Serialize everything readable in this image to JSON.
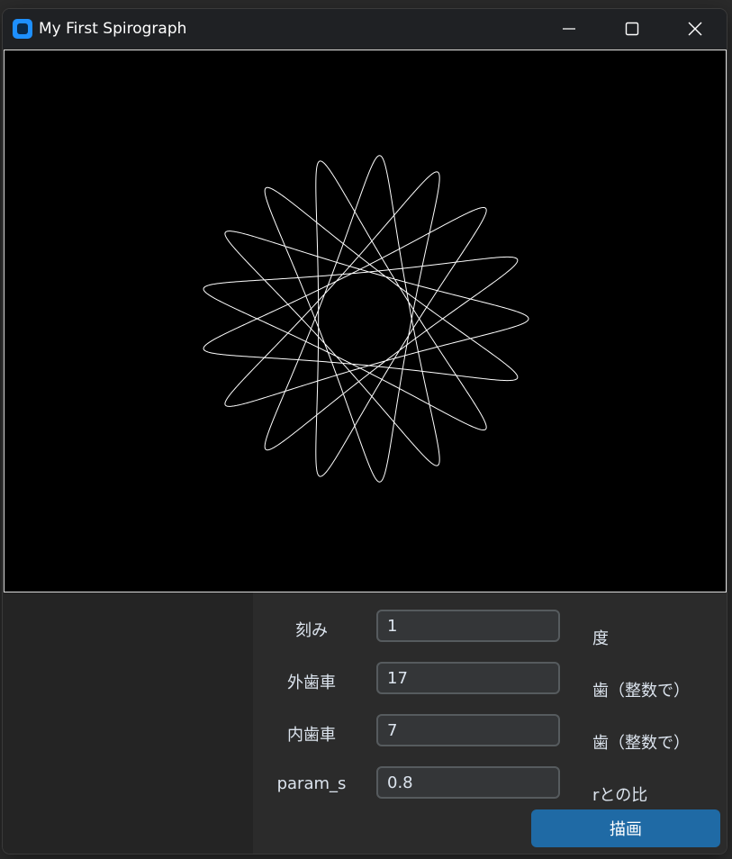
{
  "window": {
    "title": "My First Spirograph",
    "icon": "app-icon"
  },
  "spirograph": {
    "line_color": "#ffffff",
    "background": "#000000"
  },
  "form": {
    "rows": [
      {
        "label": "刻み",
        "value": "1",
        "unit": "度"
      },
      {
        "label": "外歯車",
        "value": "17",
        "unit": "歯（整数で）"
      },
      {
        "label": "内歯車",
        "value": "7",
        "unit": "歯（整数で）"
      },
      {
        "label": "param_s",
        "value": "0.8",
        "unit": "rとの比"
      }
    ],
    "draw_button": "描画"
  },
  "colors": {
    "accent": "#1f6aa5",
    "app_icon": "#1e90ff"
  }
}
